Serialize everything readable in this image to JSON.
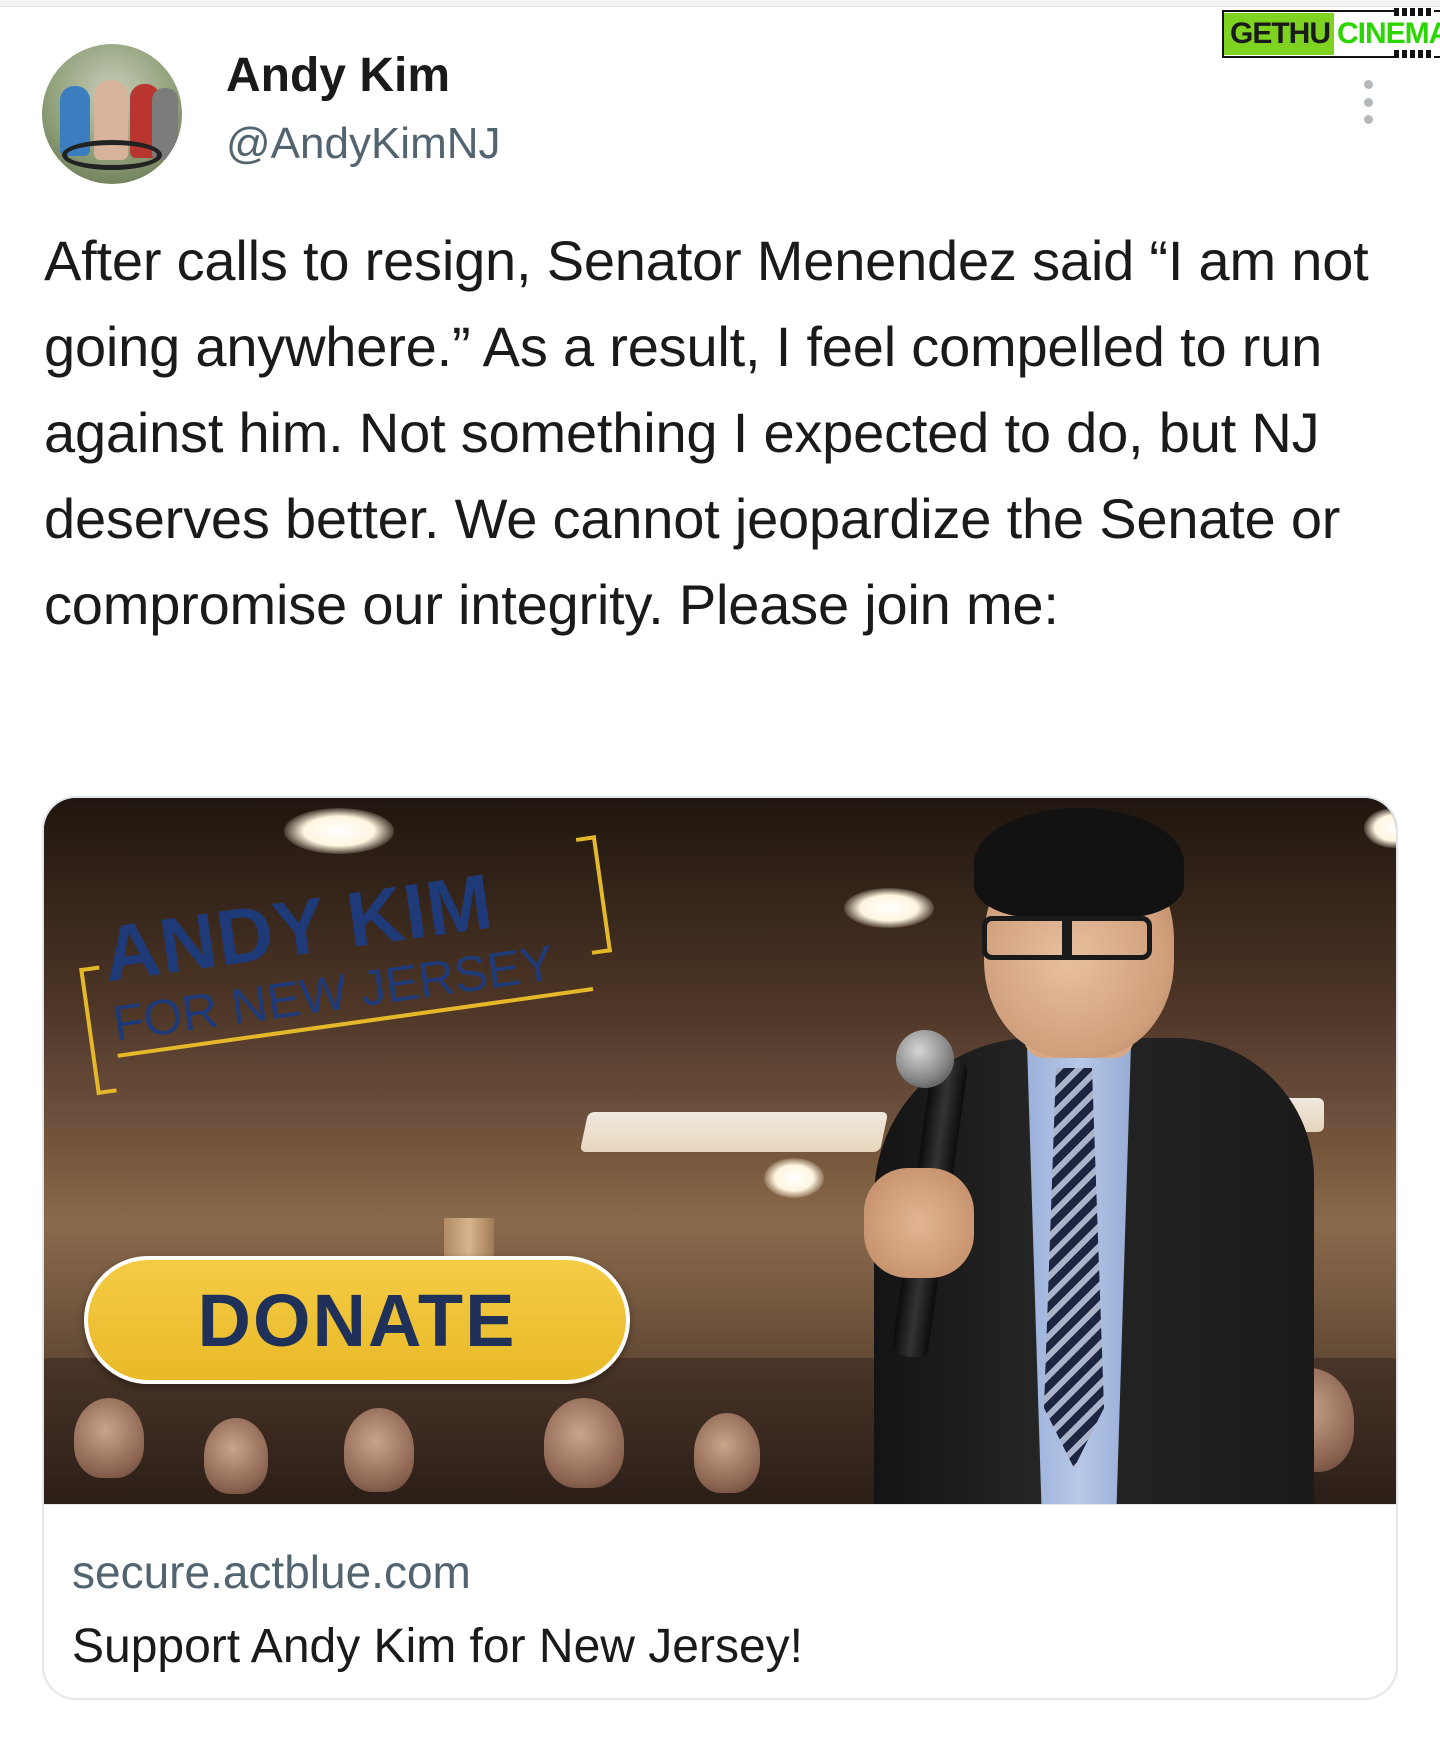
{
  "watermark": {
    "part1": "GETHU",
    "part2": "CINEMA"
  },
  "author": {
    "name": "Andy Kim",
    "handle": "@AndyKimNJ"
  },
  "tweet": {
    "text": "After calls to resign, Senator Menendez said “I am not going anywhere.” As a result, I feel compelled to run against him. Not something I expected to do, but NJ deserves better. We cannot jeopardize the Senate or compromise our integrity. Please join me:"
  },
  "link_card": {
    "logo_line1": "ANDY KIM",
    "logo_line2": "FOR NEW JERSEY",
    "donate_label": "DONATE",
    "domain": "secure.actblue.com",
    "title": "Support Andy Kim for New Jersey!"
  },
  "icons": {
    "more": "more-vertical-icon"
  },
  "colors": {
    "donate_yellow": "#f0c63a",
    "logo_navy": "#1f3a78",
    "logo_gold": "#e5b82a",
    "handle_gray": "#536471"
  }
}
